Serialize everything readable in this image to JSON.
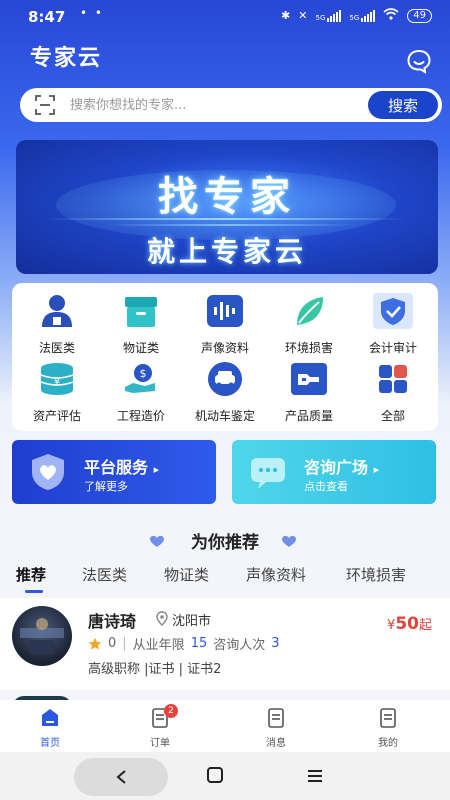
{
  "status_bar": {
    "time": "8:47",
    "dots": "• •",
    "net1": "5G",
    "net2": "5G",
    "battery": "49"
  },
  "header": {
    "title": "专家云"
  },
  "search": {
    "placeholder": "搜索你想找的专家...",
    "button": "搜索"
  },
  "banner": {
    "title": "找专家",
    "subtitle": "就上专家云"
  },
  "categories": [
    {
      "label": "法医类",
      "icon": "doctor-icon"
    },
    {
      "label": "物证类",
      "icon": "box-icon"
    },
    {
      "label": "声像资料",
      "icon": "audio-wave-icon"
    },
    {
      "label": "环境损害",
      "icon": "leaf-icon"
    },
    {
      "label": "会计审计",
      "icon": "shield-check-icon"
    },
    {
      "label": "资产评估",
      "icon": "coin-stack-icon"
    },
    {
      "label": "工程造价",
      "icon": "money-hand-icon"
    },
    {
      "label": "机动车鉴定",
      "icon": "car-icon"
    },
    {
      "label": "产品质量",
      "icon": "wrench-icon"
    },
    {
      "label": "全部",
      "icon": "grid-icon"
    }
  ],
  "services": [
    {
      "title": "平台服务",
      "sub": "了解更多",
      "arrow": "▸",
      "icon": "heart-shield-icon"
    },
    {
      "title": "咨询广场",
      "sub": "点击查看",
      "arrow": "▸",
      "icon": "chat-bubble-icon"
    }
  ],
  "recommend": {
    "title": "为你推荐",
    "tabs": [
      "推荐",
      "法医类",
      "物证类",
      "声像资料",
      "环境损害"
    ],
    "active_tab": "推荐"
  },
  "expert": {
    "name": "唐诗琦",
    "city": "沈阳市",
    "price_symbol": "¥",
    "price": "50",
    "price_suffix": "起",
    "rating": "0",
    "years_label": "从业年限",
    "years": "15",
    "consult_label": "咨询人次",
    "consults": "3",
    "tags": "高级职称 |证书 | 证书2",
    "sep": "|"
  },
  "bottom_nav": [
    {
      "label": "首页",
      "active": true
    },
    {
      "label": "订单",
      "badge": "2"
    },
    {
      "label": "消息"
    },
    {
      "label": "我的"
    }
  ],
  "colors": {
    "brand": "#2b58e0",
    "price": "#e0443a",
    "badge": "#e8433b"
  }
}
